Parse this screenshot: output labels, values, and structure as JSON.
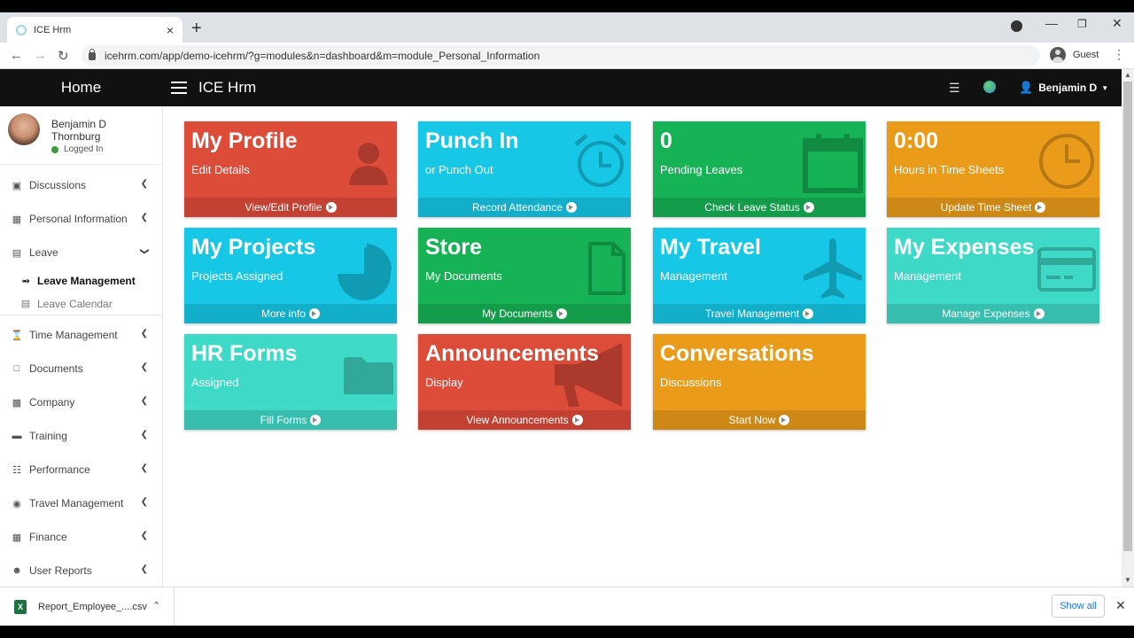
{
  "browser": {
    "tab_title": "ICE Hrm",
    "tab_close": "×",
    "new_tab": "+",
    "url": "icehrm.com/app/demo-icehrm/?g=modules&n=dashboard&m=module_Personal_Information",
    "profile": "Guest"
  },
  "header": {
    "home": "Home",
    "brand": "ICE Hrm",
    "user": "Benjamin D"
  },
  "sidebar": {
    "user_first": "Benjamin D",
    "user_last": "Thornburg",
    "status": "Logged In",
    "status_color": "#3c9a3c",
    "items": [
      {
        "label": "Discussions",
        "icon": "comments-icon"
      },
      {
        "label": "Personal Information",
        "icon": "grid-icon"
      },
      {
        "label": "Leave",
        "icon": "calendar-icon"
      },
      {
        "label": "Time Management",
        "icon": "hourglass-icon"
      },
      {
        "label": "Documents",
        "icon": "file-icon"
      },
      {
        "label": "Company",
        "icon": "building-icon"
      },
      {
        "label": "Training",
        "icon": "briefcase-icon"
      },
      {
        "label": "Performance",
        "icon": "sitemap-icon"
      },
      {
        "label": "Travel Management",
        "icon": "globe-icon"
      },
      {
        "label": "Finance",
        "icon": "calculator-icon"
      },
      {
        "label": "User Reports",
        "icon": "user-icon"
      }
    ],
    "leave_sub": [
      {
        "label": "Leave Management",
        "icon": "share-icon"
      },
      {
        "label": "Leave Calendar",
        "icon": "calendar-icon"
      }
    ]
  },
  "tiles": [
    {
      "big": "My Profile",
      "small": "Edit Details",
      "foot": "View/Edit Profile",
      "color": "#dd4b39",
      "icon": "user-icon"
    },
    {
      "big": "Punch In",
      "small": "or Punch Out",
      "foot": "Record Attendance",
      "color": "#16c8e6",
      "icon": "alarm-clock-icon"
    },
    {
      "big": "0",
      "small": "Pending Leaves",
      "foot": "Check Leave Status",
      "color": "#16b356",
      "icon": "calendar-icon"
    },
    {
      "big": "0:00",
      "small": "Hours in Time Sheets",
      "foot": "Update Time Sheet",
      "color": "#eb9b1a",
      "icon": "clock-icon"
    },
    {
      "big": "My Projects",
      "small": "Projects Assigned",
      "foot": "More info",
      "color": "#16c8e6",
      "icon": "pie-chart-icon"
    },
    {
      "big": "Store",
      "small": "My Documents",
      "foot": "My Documents",
      "color": "#16b356",
      "icon": "file-icon"
    },
    {
      "big": "My Travel",
      "small": "Management",
      "foot": "Travel Management",
      "color": "#16c8e6",
      "icon": "plane-icon"
    },
    {
      "big": "My Expenses",
      "small": "Management",
      "foot": "Manage Expenses",
      "color": "#3fd9c7",
      "icon": "credit-card-icon"
    },
    {
      "big": "HR Forms",
      "small": "Assigned",
      "foot": "Fill Forms",
      "color": "#3fd9c7",
      "icon": "folder-icon"
    },
    {
      "big": "Announcements",
      "small": "Display",
      "foot": "View Announcements",
      "color": "#dd4b39",
      "icon": "megaphone-icon"
    },
    {
      "big": "Conversations",
      "small": "Discussions",
      "foot": "Start Now",
      "color": "#eb9b1a",
      "icon": "comments-icon"
    }
  ],
  "downloads": {
    "file": "Report_Employee_....csv",
    "show_all": "Show all"
  }
}
